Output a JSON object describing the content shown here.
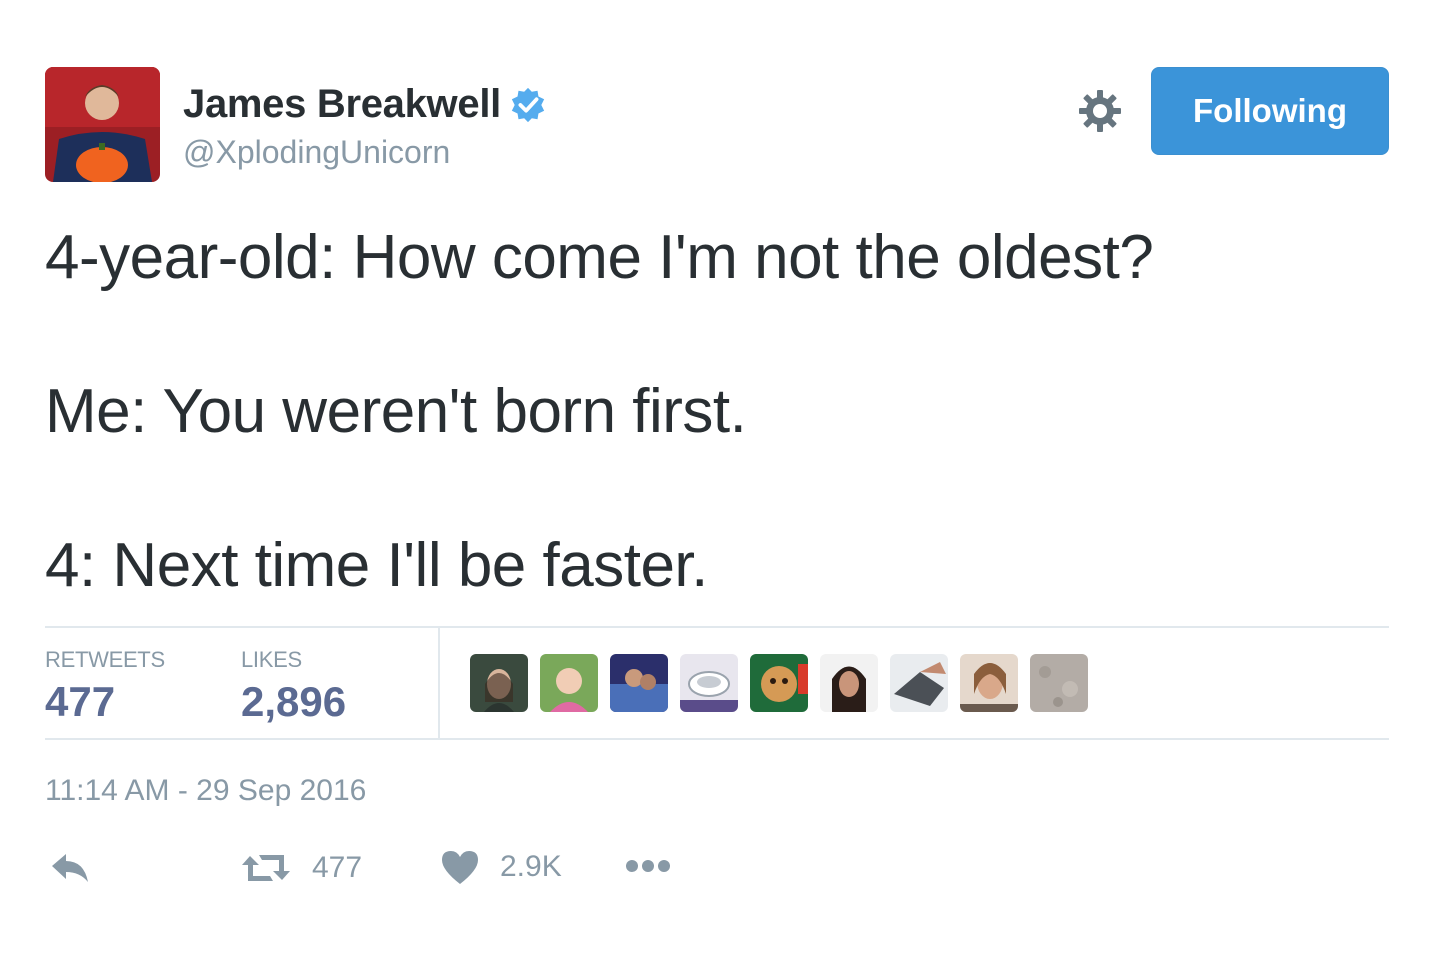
{
  "author": {
    "name": "James Breakwell",
    "handle": "@XplodingUnicorn",
    "verified": true,
    "avatar_icon": "profile-photo-man-with-pumpkin"
  },
  "header": {
    "follow_label": "Following",
    "settings_icon": "gear-icon"
  },
  "tweet": {
    "lines": [
      "4-year-old: How come I'm not the oldest?",
      "Me: You weren't born first.",
      "4: Next time I'll be faster."
    ]
  },
  "stats": {
    "retweets_label": "RETWEETS",
    "retweets_value": "477",
    "likes_label": "LIKES",
    "likes_value": "2,896"
  },
  "likers": [
    "liker-avatar-1",
    "liker-avatar-2",
    "liker-avatar-3",
    "liker-avatar-4",
    "liker-avatar-5",
    "liker-avatar-6",
    "liker-avatar-7",
    "liker-avatar-8",
    "liker-avatar-9"
  ],
  "timestamp": "11:14 AM - 29 Sep 2016",
  "actions": {
    "reply_icon": "reply-icon",
    "retweet_icon": "retweet-icon",
    "retweet_count": "477",
    "like_icon": "heart-icon",
    "like_count": "2.9K",
    "more_icon": "more-dots-icon"
  },
  "colors": {
    "accent": "#3b94d9",
    "text": "#292f33",
    "muted": "#8899a6",
    "stat_value": "#5b6a92",
    "verified_badge": "#55acee",
    "divider": "#e1e8ed"
  }
}
